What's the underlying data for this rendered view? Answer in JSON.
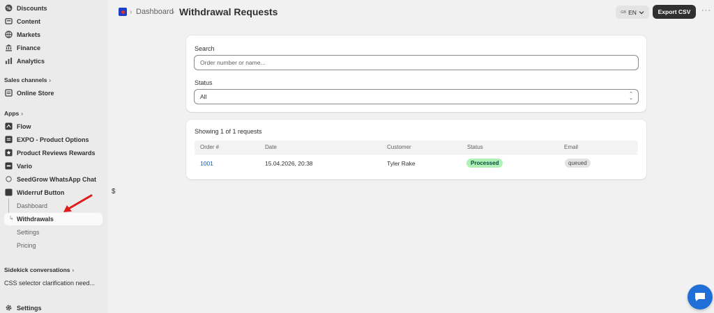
{
  "sidebar": {
    "top_items": [
      {
        "label": "Discounts",
        "icon": "discount-icon"
      },
      {
        "label": "Content",
        "icon": "content-icon"
      },
      {
        "label": "Markets",
        "icon": "globe-icon"
      },
      {
        "label": "Finance",
        "icon": "bank-icon"
      },
      {
        "label": "Analytics",
        "icon": "chart-icon"
      }
    ],
    "sales_channels_label": "Sales channels",
    "online_store_label": "Online Store",
    "apps_label": "Apps",
    "apps": [
      {
        "label": "Flow"
      },
      {
        "label": "EXPO - Product Options"
      },
      {
        "label": "Product Reviews Rewards"
      },
      {
        "label": "Vario"
      },
      {
        "label": "SeedGrow WhatsApp Chat"
      },
      {
        "label": "Widerruf Button"
      }
    ],
    "app_sub_items": [
      {
        "label": "Dashboard"
      },
      {
        "label": "Withdrawals"
      },
      {
        "label": "Settings"
      },
      {
        "label": "Pricing"
      }
    ],
    "sidekick_label": "Sidekick conversations",
    "sidekick_item": "CSS selector clarification need...",
    "settings_label": "Settings"
  },
  "header": {
    "breadcrumb": "Dashboard",
    "title": "Withdrawal Requests",
    "lang_flag": "GB",
    "lang_label": "EN",
    "export_label": "Export CSV",
    "more_label": "···"
  },
  "filters": {
    "search_label": "Search",
    "search_placeholder": "Order number or name...",
    "status_label": "Status",
    "status_value": "All"
  },
  "results": {
    "showing": "Showing 1 of 1 requests",
    "columns": [
      "Order #",
      "Date",
      "Customer",
      "Status",
      "Email"
    ],
    "rows": [
      {
        "order": "1001",
        "date": "15.04.2026, 20:38",
        "customer": "Tyler Rake",
        "status": "Processed",
        "email": "queued"
      }
    ]
  },
  "stray_text": "$",
  "colors": {
    "accent_link": "#005bd3",
    "success_badge": "#aff0b5",
    "annotation_arrow": "#e01b1b",
    "chat_bubble": "#1f6fd6"
  }
}
